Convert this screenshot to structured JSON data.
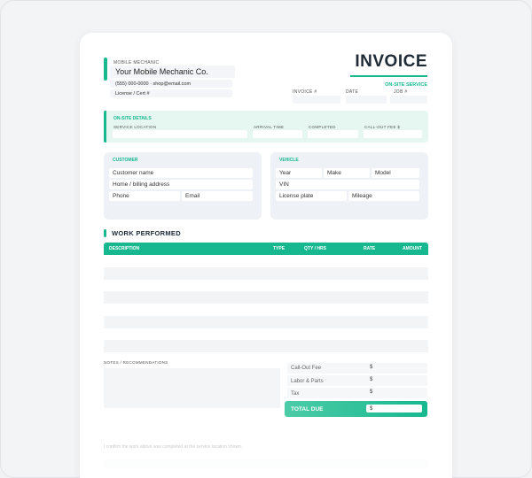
{
  "header": {
    "company_label": "MOBILE MECHANIC",
    "company_name": "Your Mobile Mechanic Co.",
    "contact": "(555) 000-0000 · shop@email.com",
    "license": "License / Cert #",
    "title": "INVOICE",
    "subtitle": "ON-SITE SERVICE",
    "meta": {
      "invoice": "INVOICE #",
      "date": "DATE",
      "job": "JOB #"
    }
  },
  "onsite": {
    "title": "ON-SITE DETAILS",
    "location": "SERVICE LOCATION",
    "arrival": "ARRIVAL TIME",
    "completed": "COMPLETED",
    "fee": "CALL-OUT FEE $"
  },
  "customer": {
    "title": "CUSTOMER",
    "name": "Customer name",
    "address": "Home / billing address",
    "phone": "Phone",
    "email": "Email"
  },
  "vehicle": {
    "title": "VEHICLE",
    "year": "Year",
    "make": "Make",
    "model": "Model",
    "vin": "VIN",
    "plate": "License plate",
    "mileage": "Mileage"
  },
  "work": {
    "title": "WORK PERFORMED",
    "columns": {
      "description": "DESCRIPTION",
      "type": "TYPE",
      "qty": "QTY / HRS",
      "rate": "RATE",
      "amount": "AMOUNT"
    }
  },
  "notes": {
    "label": "NOTES / RECOMMENDATIONS"
  },
  "totals": {
    "callout": "Call-Out Fee",
    "labor": "Labor & Parts",
    "tax": "Tax",
    "total": "TOTAL DUE",
    "currency": "$"
  },
  "footer": {
    "text": "I confirm the work above was completed at the service location shown."
  },
  "colors": {
    "accent": "#17b890",
    "panel": "#eef1f5",
    "onsite_bg": "#e6f7f1"
  }
}
